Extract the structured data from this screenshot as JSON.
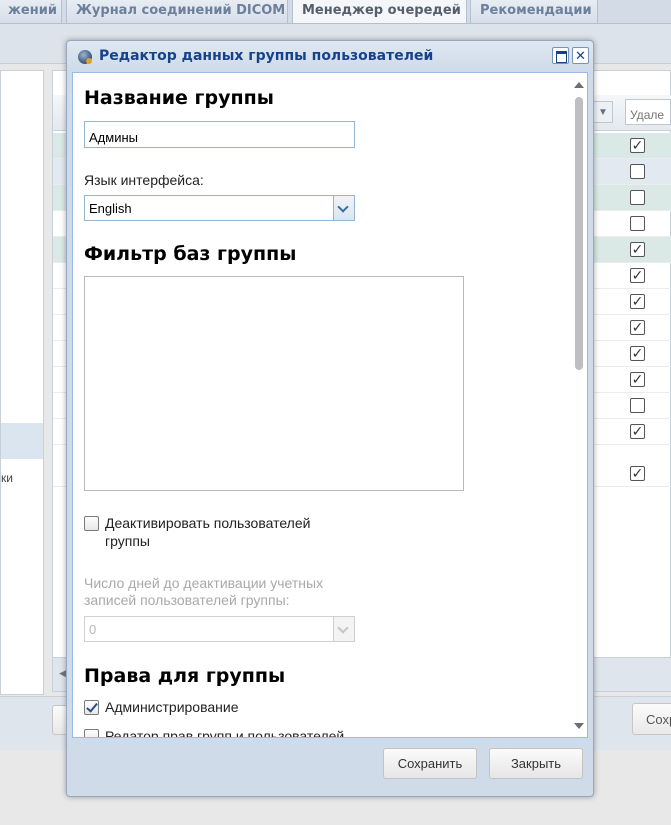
{
  "background": {
    "tabs": [
      {
        "label": "жений",
        "active": false
      },
      {
        "label": "Журнал соединений DICOM",
        "active": false
      },
      {
        "label": "Менеджер очередей",
        "active": true
      },
      {
        "label": "Рекомендации",
        "active": false
      }
    ],
    "grid": {
      "filter_placeholder": "Удале",
      "checkbox_column": [
        true,
        false,
        false,
        false,
        true,
        true,
        true,
        true,
        true,
        true,
        false,
        true,
        true
      ]
    },
    "left_panel_text": "ки",
    "bottom_button_label": "Сохр"
  },
  "dialog": {
    "title": "Редактор данных группы пользователей",
    "group_name": {
      "heading": "Название группы",
      "value": "Админы"
    },
    "interface_language": {
      "label": "Язык интерфейса:",
      "value": "English"
    },
    "db_filter": {
      "heading": "Фильтр баз группы"
    },
    "deactivate": {
      "label_line1": "Деактивировать пользователей",
      "label_line2": "группы",
      "checked": false
    },
    "days_to_deactivate": {
      "label_line1": "Число дней до деактивации учетных",
      "label_line2": "записей пользователей группы:",
      "value": "0",
      "disabled": true
    },
    "rights": {
      "heading": "Права для группы",
      "items": [
        {
          "label": "Администрирование",
          "checked": true
        },
        {
          "label": "Редатор прав групп и пользователей",
          "checked": false
        }
      ]
    },
    "buttons": {
      "save": "Сохранить",
      "close": "Закрыть"
    }
  },
  "colors": {
    "title_text": "#15428b",
    "field_border": "#94b6d2",
    "window_frame": "#cfdbe8"
  },
  "icons": [
    "group-editor-icon",
    "maximize-icon",
    "close-icon",
    "chevron-down-icon"
  ]
}
